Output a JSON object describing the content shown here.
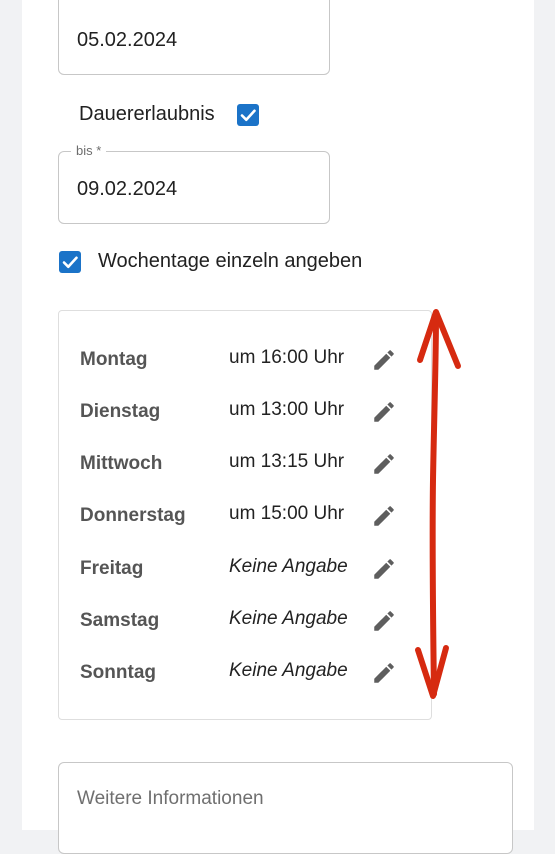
{
  "form": {
    "von_value": "05.02.2024",
    "dauererlaubnis_label": "Dauererlaubnis",
    "dauererlaubnis_checked": true,
    "bis_legend": "bis *",
    "bis_value": "09.02.2024",
    "wochentage_label": "Wochentage einzeln angeben",
    "wochentage_checked": true,
    "weitere_informationen_placeholder": "Weitere Informationen"
  },
  "days": [
    {
      "name": "Montag",
      "time": "um 16:00 Uhr"
    },
    {
      "name": "Dienstag",
      "time": "um 13:00 Uhr"
    },
    {
      "name": "Mittwoch",
      "time": "um 13:15 Uhr"
    },
    {
      "name": "Donnerstag",
      "time": "um 15:00 Uhr"
    },
    {
      "name": "Freitag",
      "time": "Keine Angabe"
    },
    {
      "name": "Samstag",
      "time": "Keine Angabe"
    },
    {
      "name": "Sonntag",
      "time": "Keine Angabe"
    }
  ],
  "icons": {
    "checkbox": "check-icon",
    "edit": "pencil-icon",
    "annotation": "double-arrow-annotation"
  },
  "colors": {
    "accent": "#1b73c8",
    "annotation": "#d62a10",
    "day_name": "#555555"
  }
}
